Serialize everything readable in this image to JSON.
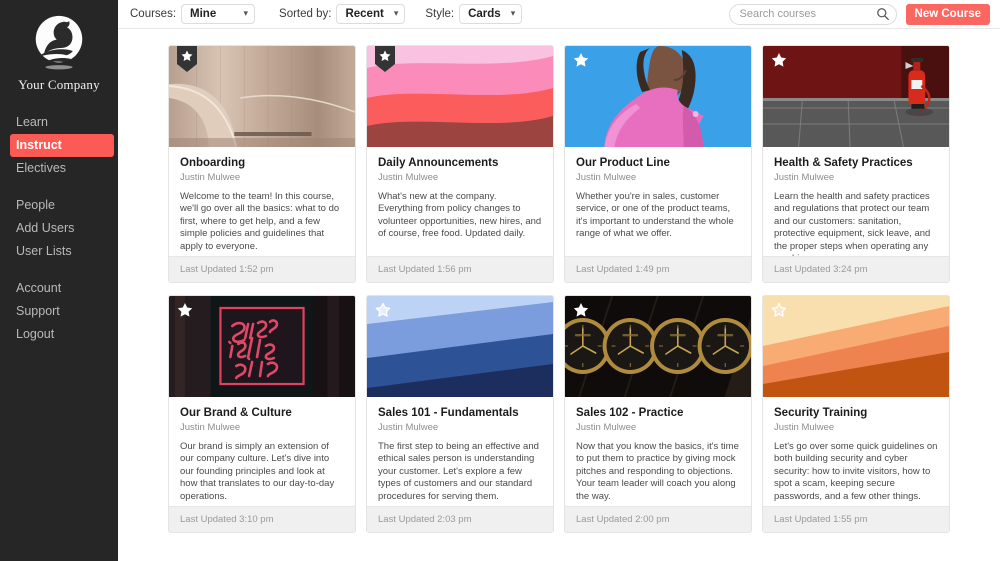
{
  "sidebar": {
    "logo_icon": "swan-logo-icon",
    "brand_name": "Your Company",
    "groups": [
      {
        "items": [
          {
            "label": "Learn",
            "active": false
          },
          {
            "label": "Instruct",
            "active": true
          },
          {
            "label": "Electives",
            "active": false
          }
        ]
      },
      {
        "items": [
          {
            "label": "People",
            "active": false
          },
          {
            "label": "Add Users",
            "active": false
          },
          {
            "label": "User Lists",
            "active": false
          }
        ]
      },
      {
        "items": [
          {
            "label": "Account",
            "active": false
          },
          {
            "label": "Support",
            "active": false
          },
          {
            "label": "Logout",
            "active": false
          }
        ]
      }
    ],
    "active_color": "#fc5a54",
    "background_color": "#262626"
  },
  "toolbar": {
    "courses_label": "Courses:",
    "courses_value": "Mine",
    "sorted_by_label": "Sorted by:",
    "sorted_by_value": "Recent",
    "style_label": "Style:",
    "style_value": "Cards",
    "chevron": "⌄",
    "search_placeholder": "Search courses",
    "search_value": "",
    "search_icon": "search-icon",
    "new_course_label": "New Course",
    "new_course_color": "#fc6660"
  },
  "cards": [
    {
      "title": "Onboarding",
      "author": "Justin Mulwee",
      "description": "Welcome to the team! In this course, we'll go over all the basics: what to do first, where to get help, and a few simple policies and guidelines that apply to everyone.",
      "updated": "Last Updated 1:52 pm",
      "star": "ribbon",
      "thumb": "wood-door-photo"
    },
    {
      "title": "Daily Announcements",
      "author": "Justin Mulwee",
      "description": "What's new at the company. Everything from policy changes to volunteer opportunities, new hires, and of course, free food. Updated daily.",
      "updated": "Last Updated 1:56 pm",
      "star": "ribbon",
      "thumb": "pink-wave-bands"
    },
    {
      "title": "Our Product Line",
      "author": "Justin Mulwee",
      "description": "Whether you're in sales, customer service, or one of the product teams, it's important to understand the whole range of what we offer.",
      "updated": "Last Updated 1:49 pm",
      "star": "filled",
      "thumb": "woman-pink-dress-photo"
    },
    {
      "title": "Health & Safety Practices",
      "author": "Justin Mulwee",
      "description": "Learn the health and safety practices and regulations that protect our team and our customers: sanitation, protective equipment, sick leave, and the proper steps when operating any machinery.",
      "updated": "Last Updated 3:24 pm",
      "star": "filled",
      "thumb": "fire-extinguisher-photo"
    },
    {
      "title": "Our Brand & Culture",
      "author": "Justin Mulwee",
      "description": "Our brand is simply an extension of our company culture. Let's dive into our founding principles and look at how that translates to our day-to-day operations.",
      "updated": "Last Updated 3:10 pm",
      "star": "filled",
      "thumb": "neon-sign-photo"
    },
    {
      "title": "Sales 101 - Fundamentals",
      "author": "Justin Mulwee",
      "description": "The first step to being an effective and ethical sales person is understanding your customer. Let's explore a few types of customers and our standard procedures for serving them.",
      "updated": "Last Updated 2:03 pm",
      "star": "outline",
      "thumb": "blue-diagonal-bands"
    },
    {
      "title": "Sales 102 - Practice",
      "author": "Justin Mulwee",
      "description": "Now that you know the basics, it's time to put them to practice by giving mock pitches and responding to objections. Your team leader will coach you along the way.",
      "updated": "Last Updated 2:00 pm",
      "star": "filled",
      "thumb": "watches-photo"
    },
    {
      "title": "Security Training",
      "author": "Justin Mulwee",
      "description": "Let's go over some quick guidelines on both building security and cyber security: how to invite visitors, how to spot a scam, keeping secure passwords, and a few other things.",
      "updated": "Last Updated 1:55 pm",
      "star": "outline",
      "thumb": "orange-diagonal-bands"
    }
  ]
}
